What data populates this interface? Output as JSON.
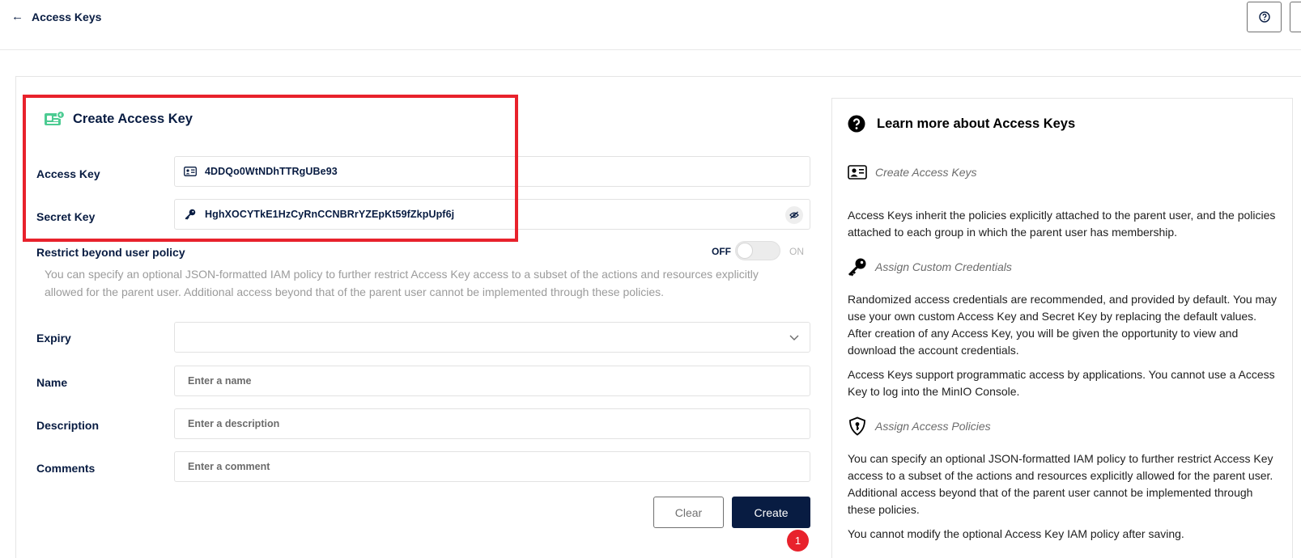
{
  "header": {
    "back_label": "Access Keys",
    "back_icon": "arrow-left-icon",
    "help_icon": "question-circle-icon"
  },
  "form": {
    "title": "Create Access Key",
    "title_icon": "access-key-card-icon",
    "access_key": {
      "label": "Access Key",
      "value": "4DDQo0WtNDhTTRgUBe93",
      "icon": "id-card-icon"
    },
    "secret_key": {
      "label": "Secret Key",
      "value": "HghXOCYTkE1HzCyRnCCNBRrYZEpKt59fZkpUpf6j",
      "icon": "key-icon",
      "toggle_icon": "eye-off-icon"
    },
    "restrict": {
      "label": "Restrict beyond user policy",
      "description": "You can specify an optional JSON-formatted IAM policy to further restrict Access Key access to a subset of the actions and resources explicitly allowed for the parent user. Additional access beyond that of the parent user cannot be implemented through these policies.",
      "off_label": "OFF",
      "on_label": "ON",
      "enabled": false
    },
    "expiry": {
      "label": "Expiry",
      "value": ""
    },
    "name": {
      "label": "Name",
      "placeholder": "Enter a name"
    },
    "description": {
      "label": "Description",
      "placeholder": "Enter a description"
    },
    "comments": {
      "label": "Comments",
      "placeholder": "Enter a comment"
    },
    "clear_label": "Clear",
    "create_label": "Create",
    "step_badge": "1"
  },
  "help": {
    "title": "Learn more about Access Keys",
    "sections": [
      {
        "heading": "Create Access Keys",
        "icon": "user-card-icon",
        "paragraphs": [
          "Access Keys inherit the policies explicitly attached to the parent user, and the policies attached to each group in which the parent user has membership."
        ]
      },
      {
        "heading": "Assign Custom Credentials",
        "icon": "key-icon",
        "paragraphs": [
          "Randomized access credentials are recommended, and provided by default. You may use your own custom Access Key and Secret Key by replacing the default values. After creation of any Access Key, you will be given the opportunity to view and download the account credentials.",
          "Access Keys support programmatic access by applications. You cannot use a Access Key to log into the MinIO Console."
        ]
      },
      {
        "heading": "Assign Access Policies",
        "icon": "shield-icon",
        "paragraphs": [
          "You can specify an optional JSON-formatted IAM policy to further restrict Access Key access to a subset of the actions and resources explicitly allowed for the parent user. Additional access beyond that of the parent user cannot be implemented through these policies.",
          "You cannot modify the optional Access Key IAM policy after saving."
        ]
      }
    ]
  },
  "colors": {
    "primary": "#081c42",
    "accent_green": "#4ccb92",
    "highlight_red": "#e8222c"
  }
}
